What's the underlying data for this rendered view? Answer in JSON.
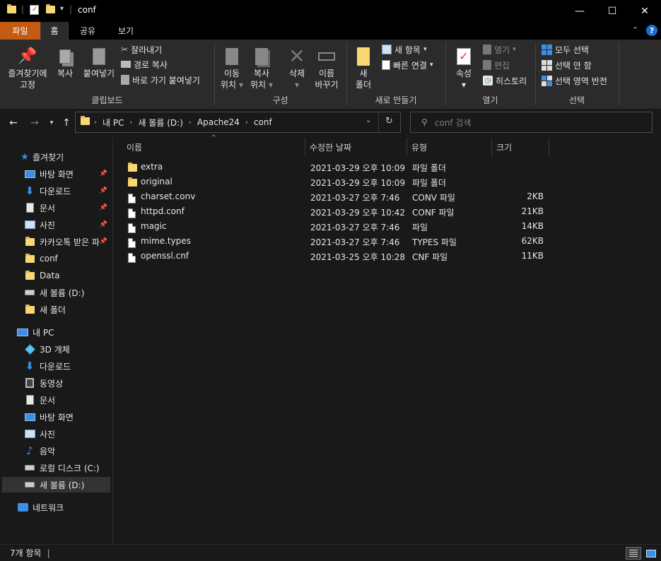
{
  "window": {
    "title": "conf",
    "minimize_icon": "—",
    "maximize_icon": "☐",
    "close_icon": "✕"
  },
  "ribbon_tabs": {
    "file": "파일",
    "home": "홈",
    "share": "공유",
    "view": "보기",
    "active": "홈",
    "file_color": "#c55a11"
  },
  "ribbon": {
    "clipboard": {
      "pin_line1": "즐겨찾기에",
      "pin_line2": "고정",
      "copy": "복사",
      "paste": "붙여넣기",
      "cut": "잘라내기",
      "copy_path": "경로 복사",
      "paste_shortcut": "바로 가기 붙여넣기",
      "group": "클립보드"
    },
    "organize": {
      "move_line1": "이동",
      "move_line2": "위치",
      "copy_line1": "복사",
      "copy_line2": "위치",
      "delete": "삭제",
      "rename_line1": "이름",
      "rename_line2": "바꾸기",
      "group": "구성"
    },
    "new": {
      "new_folder_line1": "새",
      "new_folder_line2": "폴더",
      "new_item": "새 항목",
      "easy_access": "빠른 연결",
      "group": "새로 만들기"
    },
    "open": {
      "properties": "속성",
      "open": "열기",
      "edit": "편집",
      "history": "히스토리",
      "group": "열기"
    },
    "select": {
      "select_all": "모두 선택",
      "select_none": "선택 안 함",
      "invert": "선택 영역 반전",
      "group": "선택"
    }
  },
  "address": {
    "crumbs": [
      "내 PC",
      "새 볼륨 (D:)",
      "Apache24",
      "conf"
    ],
    "search_placeholder": "conf 검색"
  },
  "nav": {
    "quick_access": "즐겨찾기",
    "quick_items": [
      {
        "label": "바탕 화면",
        "icon": "desktop-icon",
        "pinned": true
      },
      {
        "label": "다운로드",
        "icon": "download-icon",
        "pinned": true
      },
      {
        "label": "문서",
        "icon": "document-icon",
        "pinned": true
      },
      {
        "label": "사진",
        "icon": "pictures-icon",
        "pinned": true
      },
      {
        "label": "카카오톡 받은 파",
        "icon": "folder-icon",
        "pinned": true
      },
      {
        "label": "conf",
        "icon": "folder-icon",
        "pinned": false
      },
      {
        "label": "Data",
        "icon": "folder-icon",
        "pinned": false
      },
      {
        "label": "새 볼륨 (D:)",
        "icon": "drive-icon",
        "pinned": false
      },
      {
        "label": "새 폴더",
        "icon": "folder-icon",
        "pinned": false
      }
    ],
    "this_pc": "내 PC",
    "pc_items": [
      {
        "label": "3D 개체",
        "icon": "3d-objects-icon"
      },
      {
        "label": "다운로드",
        "icon": "download-icon"
      },
      {
        "label": "동영상",
        "icon": "video-icon"
      },
      {
        "label": "문서",
        "icon": "document-icon"
      },
      {
        "label": "바탕 화면",
        "icon": "desktop-icon"
      },
      {
        "label": "사진",
        "icon": "pictures-icon"
      },
      {
        "label": "음악",
        "icon": "music-icon"
      },
      {
        "label": "로컬 디스크 (C:)",
        "icon": "drive-icon"
      },
      {
        "label": "새 볼륨 (D:)",
        "icon": "drive-icon"
      }
    ],
    "network": "네트워크"
  },
  "columns": {
    "name": "이름",
    "modified": "수정한 날짜",
    "type": "유형",
    "size": "크기"
  },
  "files": [
    {
      "name": "extra",
      "modified": "2021-03-29 오후 10:09",
      "type": "파일 폴더",
      "size": "",
      "icon": "folder-icon"
    },
    {
      "name": "original",
      "modified": "2021-03-29 오후 10:09",
      "type": "파일 폴더",
      "size": "",
      "icon": "folder-icon"
    },
    {
      "name": "charset.conv",
      "modified": "2021-03-27 오후 7:46",
      "type": "CONV 파일",
      "size": "2KB",
      "icon": "file-icon"
    },
    {
      "name": "httpd.conf",
      "modified": "2021-03-29 오후 10:42",
      "type": "CONF 파일",
      "size": "21KB",
      "icon": "file-icon"
    },
    {
      "name": "magic",
      "modified": "2021-03-27 오후 7:46",
      "type": "파일",
      "size": "14KB",
      "icon": "file-icon"
    },
    {
      "name": "mime.types",
      "modified": "2021-03-27 오후 7:46",
      "type": "TYPES 파일",
      "size": "62KB",
      "icon": "file-icon"
    },
    {
      "name": "openssl.cnf",
      "modified": "2021-03-25 오후 10:28",
      "type": "CNF 파일",
      "size": "11KB",
      "icon": "file-icon"
    }
  ],
  "status": {
    "count": "7개 항목"
  }
}
